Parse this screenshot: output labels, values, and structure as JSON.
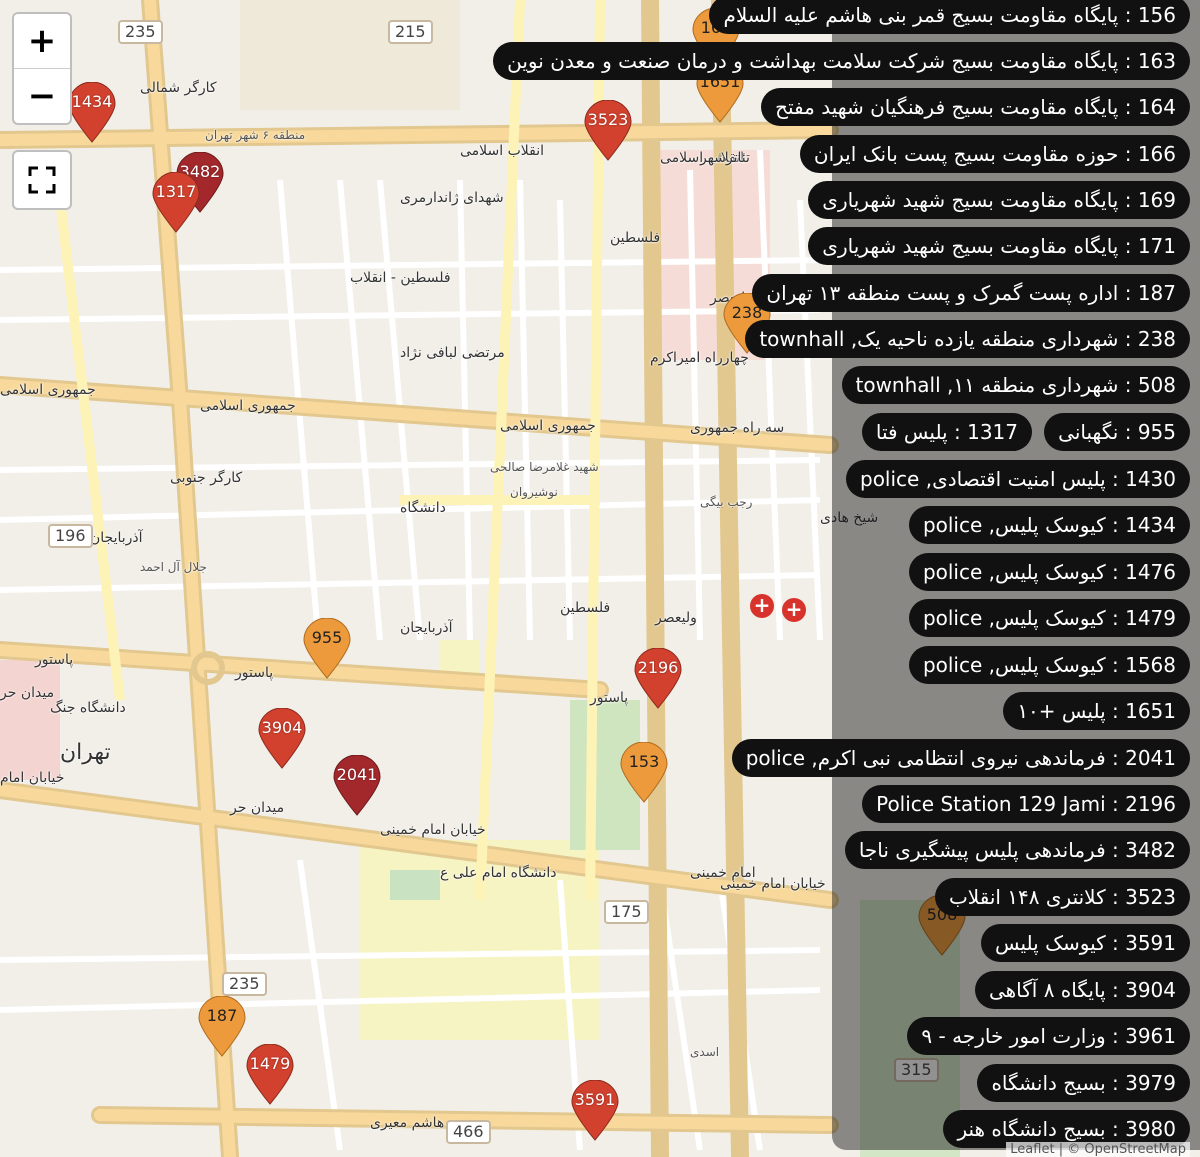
{
  "map": {
    "road_labels": [
      {
        "text": "انقلاب اسلامی",
        "big": false
      },
      {
        "text": "انقلاب اسلامی",
        "big": false
      },
      {
        "text": "جمهوری اسلامی",
        "big": false
      },
      {
        "text": "جمهوری اسلامی",
        "big": false
      },
      {
        "text": "جمهوری اسلامی",
        "big": false
      },
      {
        "text": "سه راه جمهوری",
        "big": false
      },
      {
        "text": "خیابان امام خمینی",
        "big": false
      },
      {
        "text": "خیابان امام خمینی",
        "big": false
      },
      {
        "text": "خیابان امام",
        "big": false
      },
      {
        "text": "میدان حر",
        "big": false
      },
      {
        "text": "کارگر جنوبی",
        "big": false
      },
      {
        "text": "کارگر شمالی",
        "big": false
      },
      {
        "text": "ولیعصر",
        "big": false
      },
      {
        "text": "ولیعصر",
        "big": false
      },
      {
        "text": "فلسطین",
        "big": false
      },
      {
        "text": "فلسطین",
        "big": false
      },
      {
        "text": "دانشگاه",
        "big": false
      },
      {
        "text": "آذربایجان",
        "big": false
      },
      {
        "text": "آذربایجان",
        "big": false
      },
      {
        "text": "پاستور",
        "big": false
      },
      {
        "text": "پاستور",
        "big": false
      },
      {
        "text": "پاستور",
        "big": false
      },
      {
        "text": "هاشم معیری",
        "big": false
      },
      {
        "text": "تئاترشهر",
        "big": false
      },
      {
        "text": "منطقه ۶ شهر تهران",
        "big": false
      },
      {
        "text": "تهران",
        "big": true
      },
      {
        "text": "دانشگاه امام علی ع",
        "big": false
      },
      {
        "text": "میدان حر",
        "big": false
      },
      {
        "text": "شهدای ژاندارمری",
        "big": false
      },
      {
        "text": "فلسطین - انقلاب",
        "big": false
      },
      {
        "text": "چهارراه امیراکرم",
        "big": false
      },
      {
        "text": "مرتضی لبافی نژاد",
        "big": false
      },
      {
        "text": "شیخ هادی",
        "big": false
      },
      {
        "text": "رجب بیگی",
        "big": false
      },
      {
        "text": "شهید غلامرضا صالحی",
        "big": false
      },
      {
        "text": "نوشیروان",
        "big": false
      },
      {
        "text": "امام خمینی",
        "big": false
      },
      {
        "text": "دانشگاه جنگ",
        "big": false
      },
      {
        "text": "جلال آل احمد",
        "big": false
      },
      {
        "text": "اسدی",
        "big": false
      }
    ],
    "shields": [
      "235",
      "215",
      "196",
      "235",
      "175",
      "466",
      "315"
    ],
    "markers": [
      {
        "label": "1434",
        "color": "red"
      },
      {
        "label": "3482",
        "color": "darkred"
      },
      {
        "label": "1317",
        "color": "red"
      },
      {
        "label": "3523",
        "color": "red"
      },
      {
        "label": "163",
        "color": "orange"
      },
      {
        "label": "1651",
        "color": "orange"
      },
      {
        "label": "238",
        "color": "orange"
      },
      {
        "label": "955",
        "color": "orange"
      },
      {
        "label": "2196",
        "color": "red"
      },
      {
        "label": "153",
        "color": "orange"
      },
      {
        "label": "3904",
        "color": "red"
      },
      {
        "label": "2041",
        "color": "darkred"
      },
      {
        "label": "187",
        "color": "orange"
      },
      {
        "label": "1479",
        "color": "red"
      },
      {
        "label": "3591",
        "color": "red"
      },
      {
        "label": "508",
        "color": "orange"
      }
    ]
  },
  "controls": {
    "zoom_in": "+",
    "zoom_out": "−"
  },
  "legend": [
    "156 : پایگاه مقاومت بسیج قمر بنی هاشم علیه السلام",
    "163 : پایگاه مقاومت بسیج شرکت سلامت بهداشت و درمان صنعت و معدن نوین",
    "164 : پایگاه مقاومت بسیج فرهنگیان شهید مفتح",
    "166 : حوزه مقاومت بسیج پست بانک ایران",
    "169 : پایگاه مقاومت بسیج شهید شهریاری",
    "171 : پایگاه مقاومت بسیج شهید شهریاری",
    "187 : اداره پست گمرک و پست منطقه ۱۳ تهران",
    "238 : شهرداری منطقه یازده ناحیه یک, townhall",
    "508 : شهرداری منطقه ۱۱, townhall",
    "955 : نگهبانی",
    "1317 : پلیس فتا",
    "1430 : پلیس امنیت اقتصادی, police",
    "1434 : کیوسک پلیس, police",
    "1476 : کیوسک پلیس, police",
    "1479 : کیوسک پلیس, police",
    "1568 : کیوسک پلیس, police",
    "1651 : پلیس +۱۰",
    "2041 : فرماندهی نیروی انتظامی نبی اکرم, police",
    "2196 : Police Station 129 Jami",
    "3482 : فرماندهی پلیس پیشگیری ناجا",
    "3523 : کلانتری ۱۴۸ انقلاب",
    "3591 : کیوسک پلیس",
    "3904 : پایگاه ۸ آگاهی",
    "3961 : وزارت امور خارجه - ۹",
    "3979 : بسیج دانشگاه",
    "3980 : بسیج دانشگاه هنر"
  ],
  "attribution": "Leaflet | © OpenStreetMap",
  "colors": {
    "red": "#d2412e",
    "darkred": "#a3282b",
    "orange": "#ec9a3b",
    "panel": "#111111"
  }
}
